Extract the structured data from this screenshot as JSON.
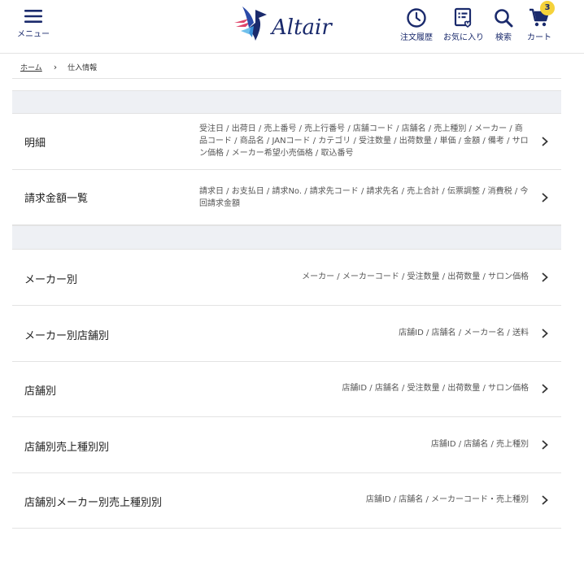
{
  "header": {
    "menu_label": "メニュー",
    "logo_text": "Altair",
    "nav": [
      {
        "label": "注文履歴",
        "icon": "clock-icon"
      },
      {
        "label": "お気に入り",
        "icon": "favorite-list-icon"
      },
      {
        "label": "検索",
        "icon": "search-icon"
      },
      {
        "label": "カート",
        "icon": "cart-icon",
        "badge": "3"
      }
    ],
    "colors": {
      "primary": "#1a2a6c",
      "badge": "#f5d23a"
    }
  },
  "breadcrumb": {
    "home": "ホーム",
    "separator": "›",
    "current": "仕入情報"
  },
  "sections": [
    {
      "rows": [
        {
          "title": "明細",
          "desc": "受注日 / 出荷日 / 売上番号 / 売上行番号 / 店舗コード / 店舗名 / 売上種別 / メーカー / 商品コード / 商品名 / JANコード / カテゴリ / 受注数量 / 出荷数量 / 単価 / 金額 / 備考 / サロン価格 / メーカー希望小売価格 / 取込番号"
        },
        {
          "title": "請求金額一覧",
          "desc": "請求日 / お支払日 / 請求No. / 請求先コード / 請求先名 / 売上合計 / 伝票調整 / 消費税 / 今回請求金額"
        }
      ]
    },
    {
      "rows": [
        {
          "title": "メーカー別",
          "desc": "メーカー / メーカーコード / 受注数量 / 出荷数量 / サロン価格"
        },
        {
          "title": "メーカー別店舗別",
          "desc": "店舗ID / 店舗名 / メーカー名 / 送料"
        },
        {
          "title": "店舗別",
          "desc": "店舗ID / 店舗名 / 受注数量 / 出荷数量 / サロン価格"
        },
        {
          "title": "店舗別売上種別別",
          "desc": "店舗ID / 店舗名 / 売上種別"
        },
        {
          "title": "店舗別メーカー別売上種別別",
          "desc": "店舗ID / 店舗名 / メーカーコード・売上種別"
        }
      ]
    }
  ]
}
